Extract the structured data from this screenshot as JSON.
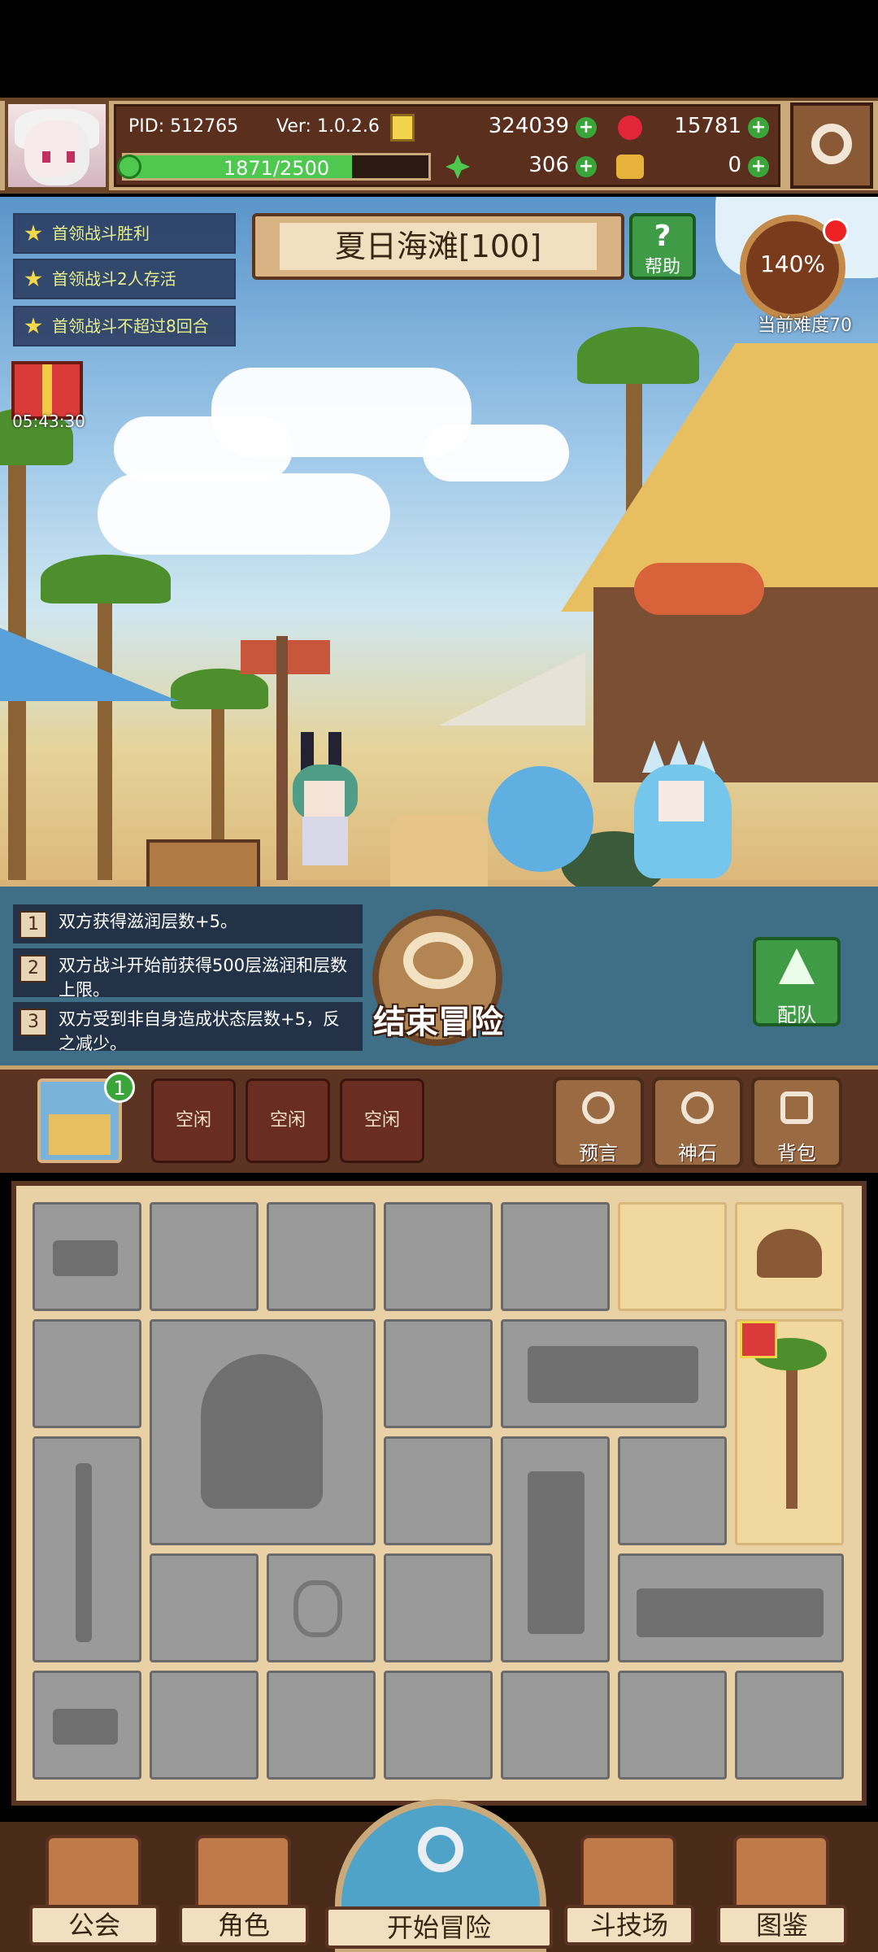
{
  "player": {
    "pid": "PID: 512765",
    "version": "Ver: 1.0.2.6",
    "xp_text": "1871/2500",
    "xp_progress": 0.748
  },
  "currencies": {
    "gold": "324039",
    "gems": "15781",
    "clover": "306",
    "keys": "0"
  },
  "stage": {
    "title": "夏日海滩[100]",
    "help_label": "帮助",
    "difficulty_percent": "140%",
    "difficulty_label": "当前难度70"
  },
  "quests": [
    "首领战斗胜利",
    "首领战斗2人存活",
    "首领战斗不超过8回合"
  ],
  "gift": {
    "timer": "05:43:30"
  },
  "rules": [
    {
      "num": "1",
      "text": "双方获得滋润层数+5。"
    },
    {
      "num": "2",
      "text": "双方战斗开始前获得500层滋润和层数上限。"
    },
    {
      "num": "3",
      "text": "双方受到非自身造成状态层数+5，反之减少。"
    }
  ],
  "actions": {
    "end_adventure": "结束冒险",
    "team": "配队"
  },
  "slots": {
    "map_badge": "1",
    "idle": [
      "空闲",
      "空闲",
      "空闲"
    ],
    "tools": [
      "预言",
      "神石",
      "背包"
    ]
  },
  "nav": {
    "items": [
      "公会",
      "角色",
      "开始冒险",
      "斗技场",
      "图鉴"
    ]
  },
  "colors": {
    "hud_brown": "#5a2f1e",
    "accent_green": "#3f9b46",
    "quest_text": "#e6f08c",
    "xp_green": "#4fc84f"
  }
}
